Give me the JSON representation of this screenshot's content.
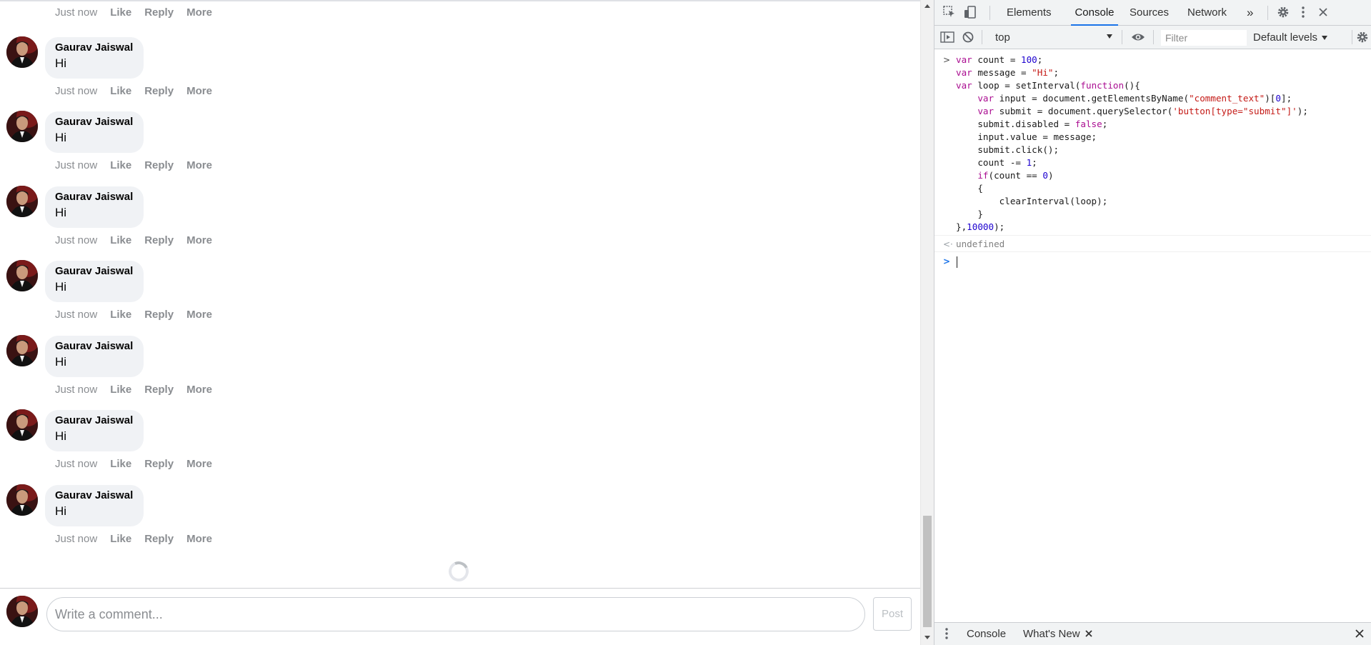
{
  "comments": {
    "top_actions": {
      "time": "Just now",
      "like": "Like",
      "reply": "Reply",
      "more": "More"
    },
    "items": [
      {
        "author": "Gaurav Jaiswal",
        "text": "Hi",
        "time": "Just now",
        "like": "Like",
        "reply": "Reply",
        "more": "More"
      },
      {
        "author": "Gaurav Jaiswal",
        "text": "Hi",
        "time": "Just now",
        "like": "Like",
        "reply": "Reply",
        "more": "More"
      },
      {
        "author": "Gaurav Jaiswal",
        "text": "Hi",
        "time": "Just now",
        "like": "Like",
        "reply": "Reply",
        "more": "More"
      },
      {
        "author": "Gaurav Jaiswal",
        "text": "Hi",
        "time": "Just now",
        "like": "Like",
        "reply": "Reply",
        "more": "More"
      },
      {
        "author": "Gaurav Jaiswal",
        "text": "Hi",
        "time": "Just now",
        "like": "Like",
        "reply": "Reply",
        "more": "More"
      },
      {
        "author": "Gaurav Jaiswal",
        "text": "Hi",
        "time": "Just now",
        "like": "Like",
        "reply": "Reply",
        "more": "More"
      },
      {
        "author": "Gaurav Jaiswal",
        "text": "Hi",
        "time": "Just now",
        "like": "Like",
        "reply": "Reply",
        "more": "More"
      }
    ]
  },
  "compose": {
    "placeholder": "Write a comment...",
    "post_label": "Post"
  },
  "devtools": {
    "tabs": [
      "Elements",
      "Console",
      "Sources",
      "Network"
    ],
    "active_tab": "Console",
    "more_tabs_icon": "»",
    "context": "top",
    "filter_placeholder": "Filter",
    "levels": "Default levels",
    "console_input": [
      "var count = 100;",
      "var message = \"Hi\";",
      "var loop = setInterval(function(){",
      "    var input = document.getElementsByName(\"comment_text\")[0];",
      "    var submit = document.querySelector('button[type=\"submit\"]');",
      "    submit.disabled = false;",
      "    input.value = message;",
      "    submit.click();",
      "    count -= 1;",
      "    if(count == 0)",
      "    {",
      "        clearInterval(loop);",
      "    }",
      "},10000);"
    ],
    "result": "undefined",
    "drawer_tabs": [
      "Console",
      "What's New"
    ]
  },
  "colors": {
    "accent": "#1a73e8",
    "bubble": "#f0f2f5",
    "meta": "#8a8d91"
  }
}
